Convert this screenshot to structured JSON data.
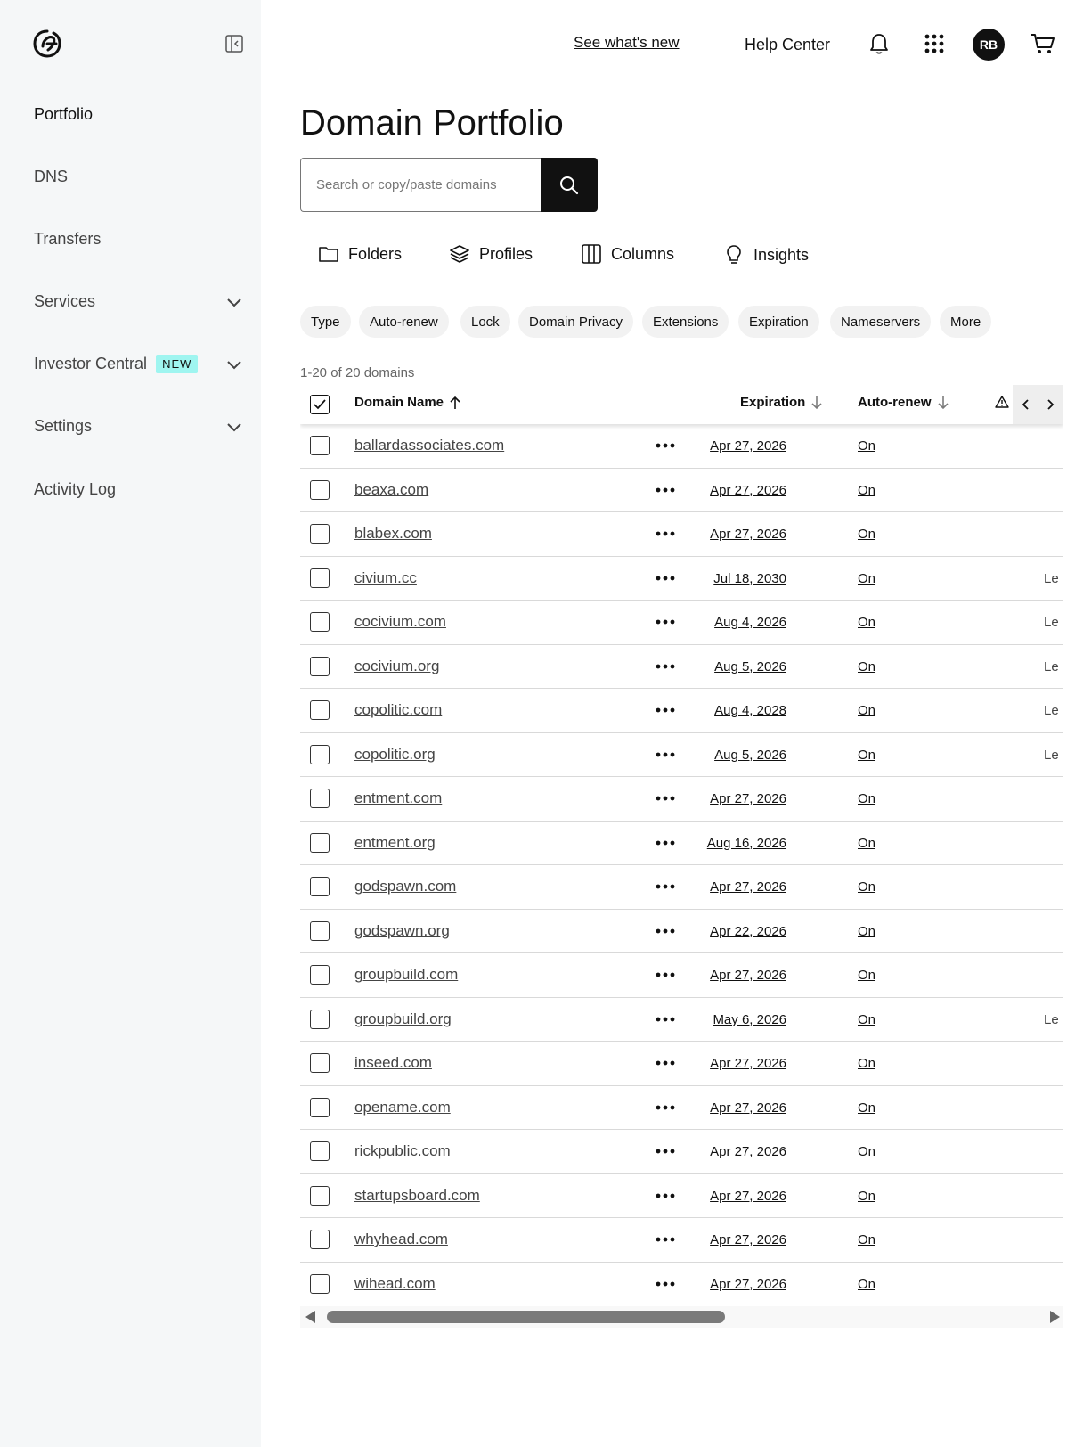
{
  "sidebar": {
    "items": [
      {
        "label": "Portfolio"
      },
      {
        "label": "DNS"
      },
      {
        "label": "Transfers"
      },
      {
        "label": "Services"
      },
      {
        "label": "Investor Central",
        "badge": "NEW"
      },
      {
        "label": "Settings"
      },
      {
        "label": "Activity Log"
      }
    ]
  },
  "header": {
    "whats_new": "See what's new",
    "help": "Help Center",
    "avatar_initials": "RB"
  },
  "main": {
    "title": "Domain Portfolio",
    "search_placeholder": "Search or copy/paste domains",
    "toolbar": {
      "folders": "Folders",
      "profiles": "Profiles",
      "columns": "Columns",
      "insights": "Insights"
    },
    "filters": [
      "Type",
      "Auto-renew",
      "Lock",
      "Domain Privacy",
      "Extensions",
      "Expiration",
      "Nameservers",
      "More"
    ],
    "count": "1-20 of 20 domains",
    "table": {
      "headers": {
        "domain": "Domain Name",
        "expiration": "Expiration",
        "autorenew": "Auto-renew"
      },
      "rows": [
        {
          "domain": "ballardassociates.com",
          "exp": "Apr 27, 2026",
          "auto": "On",
          "extra": ""
        },
        {
          "domain": "beaxa.com",
          "exp": "Apr 27, 2026",
          "auto": "On",
          "extra": ""
        },
        {
          "domain": "blabex.com",
          "exp": "Apr 27, 2026",
          "auto": "On",
          "extra": ""
        },
        {
          "domain": "civium.cc",
          "exp": "Jul 18, 2030",
          "auto": "On",
          "extra": "Le"
        },
        {
          "domain": "cocivium.com",
          "exp": "Aug 4, 2026",
          "auto": "On",
          "extra": "Le"
        },
        {
          "domain": "cocivium.org",
          "exp": "Aug 5, 2026",
          "auto": "On",
          "extra": "Le"
        },
        {
          "domain": "copolitic.com",
          "exp": "Aug 4, 2028",
          "auto": "On",
          "extra": "Le"
        },
        {
          "domain": "copolitic.org",
          "exp": "Aug 5, 2026",
          "auto": "On",
          "extra": "Le"
        },
        {
          "domain": "entment.com",
          "exp": "Apr 27, 2026",
          "auto": "On",
          "extra": ""
        },
        {
          "domain": "entment.org",
          "exp": "Aug 16, 2026",
          "auto": "On",
          "extra": ""
        },
        {
          "domain": "godspawn.com",
          "exp": "Apr 27, 2026",
          "auto": "On",
          "extra": ""
        },
        {
          "domain": "godspawn.org",
          "exp": "Apr 22, 2026",
          "auto": "On",
          "extra": ""
        },
        {
          "domain": "groupbuild.com",
          "exp": "Apr 27, 2026",
          "auto": "On",
          "extra": ""
        },
        {
          "domain": "groupbuild.org",
          "exp": "May 6, 2026",
          "auto": "On",
          "extra": "Le"
        },
        {
          "domain": "inseed.com",
          "exp": "Apr 27, 2026",
          "auto": "On",
          "extra": ""
        },
        {
          "domain": "opename.com",
          "exp": "Apr 27, 2026",
          "auto": "On",
          "extra": ""
        },
        {
          "domain": "rickpublic.com",
          "exp": "Apr 27, 2026",
          "auto": "On",
          "extra": ""
        },
        {
          "domain": "startupsboard.com",
          "exp": "Apr 27, 2026",
          "auto": "On",
          "extra": ""
        },
        {
          "domain": "whyhead.com",
          "exp": "Apr 27, 2026",
          "auto": "On",
          "extra": ""
        },
        {
          "domain": "wihead.com",
          "exp": "Apr 27, 2026",
          "auto": "On",
          "extra": ""
        }
      ]
    }
  },
  "colors": {
    "sidebar_bg": "#f5f7f8",
    "accent_dark": "#111111",
    "badge_new": "#9ff5f0",
    "chip_bg": "#f2f2f2"
  },
  "icons": {
    "logo": "godaddy-logo-icon",
    "collapse": "sidebar-collapse-icon",
    "bell": "bell-icon",
    "apps": "apps-grid-icon",
    "cart": "cart-icon",
    "search": "search-icon",
    "folder": "folder-icon",
    "profiles": "layers-icon",
    "columns": "columns-icon",
    "insights": "lightbulb-icon",
    "more": "more-horizontal-icon",
    "warning": "warning-icon"
  }
}
